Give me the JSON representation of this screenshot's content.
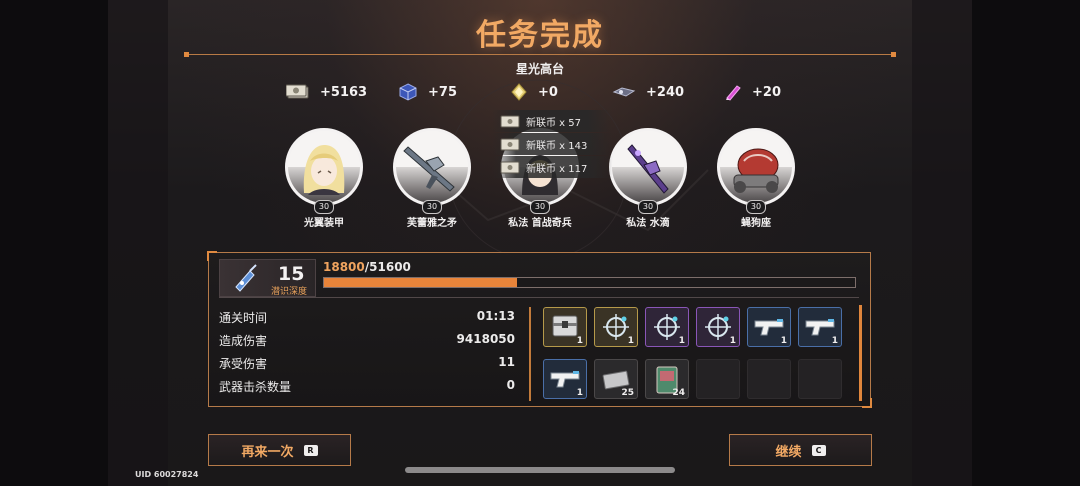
{
  "header": {
    "title": "任务完成",
    "stage_name": "星光高台"
  },
  "rewards": [
    {
      "icon": "cash-icon",
      "value": "+5163"
    },
    {
      "icon": "cube-icon",
      "value": "+75"
    },
    {
      "icon": "crystal-icon",
      "value": "+0"
    },
    {
      "icon": "drone-icon",
      "value": "+240"
    },
    {
      "icon": "crayon-icon",
      "value": "+20"
    }
  ],
  "drops": [
    {
      "label": "新联币 x 57"
    },
    {
      "label": "新联币 x 143"
    },
    {
      "label": "新联币 x 117"
    }
  ],
  "team": [
    {
      "name": "光翼装甲",
      "level": "30",
      "icon": "blonde-character-portrait"
    },
    {
      "name": "芙蕾雅之矛",
      "level": "30",
      "icon": "rifle-weapon-icon"
    },
    {
      "name": "私法 首战奇兵",
      "level": "30",
      "icon": "character-portrait"
    },
    {
      "name": "私法 水滴",
      "level": "30",
      "icon": "purple-rifle-icon"
    },
    {
      "name": "蝇狗座",
      "level": "30",
      "icon": "red-mech-icon"
    }
  ],
  "progress": {
    "depth_value": "15",
    "depth_label": "潜识深度",
    "xp_current": "18800",
    "xp_separator": "/",
    "xp_max": "51600",
    "xp_fraction": 0.364
  },
  "stats": [
    {
      "label": "通关时间",
      "value": "01:13"
    },
    {
      "label": "造成伤害",
      "value": "9418050"
    },
    {
      "label": "承受伤害",
      "value": "11"
    },
    {
      "label": "武器击杀数量",
      "value": "0"
    }
  ],
  "loot": [
    {
      "icon": "supply-box-icon",
      "count": "1",
      "rarity": "gold"
    },
    {
      "icon": "scope-mod-icon",
      "count": "1",
      "rarity": "gold"
    },
    {
      "icon": "scope-mod-icon",
      "count": "1",
      "rarity": "purple"
    },
    {
      "icon": "scope-mod-icon",
      "count": "1",
      "rarity": "purple"
    },
    {
      "icon": "pistol-icon",
      "count": "1",
      "rarity": "blue"
    },
    {
      "icon": "pistol-icon",
      "count": "1",
      "rarity": "blue"
    },
    {
      "icon": "pistol-icon",
      "count": "1",
      "rarity": "blue"
    },
    {
      "icon": "chip-icon",
      "count": "25",
      "rarity": "gray"
    },
    {
      "icon": "card-icon",
      "count": "24",
      "rarity": "gray"
    },
    {
      "icon": "empty-slot",
      "count": "",
      "rarity": "empty"
    },
    {
      "icon": "empty-slot",
      "count": "",
      "rarity": "empty"
    },
    {
      "icon": "empty-slot",
      "count": "",
      "rarity": "empty"
    }
  ],
  "buttons": {
    "retry_label": "再来一次",
    "retry_key": "R",
    "continue_label": "继续",
    "continue_key": "C"
  },
  "footer": {
    "uid": "UID 60027824"
  },
  "colors": {
    "accent": "#f2a964",
    "bar_fill": "#e8843a",
    "panel_border": "#b57a49"
  }
}
